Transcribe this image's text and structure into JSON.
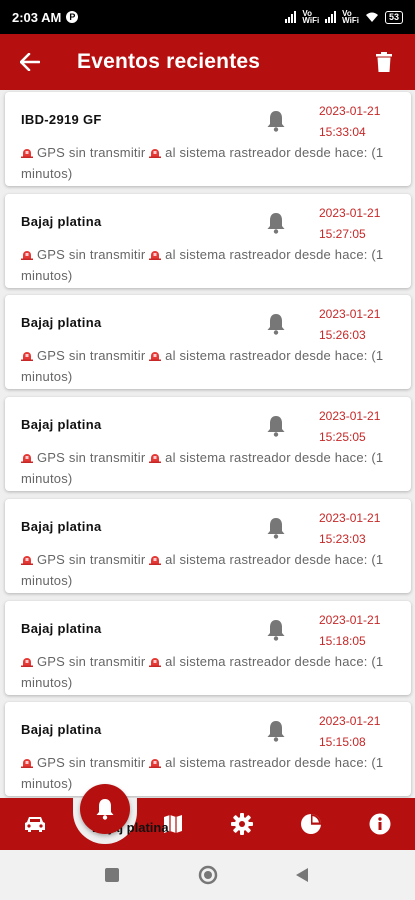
{
  "status_bar": {
    "time": "2:03 AM",
    "network_label_1": "Vo\nWiFi",
    "network_label_2": "Vo\nWiFi",
    "battery": "53"
  },
  "header": {
    "title": "Eventos recientes",
    "back_icon": "arrow-left-icon",
    "delete_icon": "trash-icon"
  },
  "events": [
    {
      "title": "IBD-2919 GF",
      "date": "2023-01-21",
      "time": "15:33:04",
      "message_part1": "GPS sin transmitir",
      "message_part2": "al sistema rastreador desde hace: (1 minutos)"
    },
    {
      "title": "Bajaj platina",
      "date": "2023-01-21",
      "time": "15:27:05",
      "message_part1": "GPS sin transmitir",
      "message_part2": "al sistema rastreador desde hace: (1 minutos)"
    },
    {
      "title": "Bajaj platina",
      "date": "2023-01-21",
      "time": "15:26:03",
      "message_part1": "GPS sin transmitir",
      "message_part2": "al sistema rastreador desde hace: (1 minutos)"
    },
    {
      "title": "Bajaj platina",
      "date": "2023-01-21",
      "time": "15:25:05",
      "message_part1": "GPS sin transmitir",
      "message_part2": "al sistema rastreador desde hace: (1 minutos)"
    },
    {
      "title": "Bajaj platina",
      "date": "2023-01-21",
      "time": "15:23:03",
      "message_part1": "GPS sin transmitir",
      "message_part2": "al sistema rastreador desde hace: (1 minutos)"
    },
    {
      "title": "Bajaj platina",
      "date": "2023-01-21",
      "time": "15:18:05",
      "message_part1": "GPS sin transmitir",
      "message_part2": "al sistema rastreador desde hace: (1 minutos)"
    },
    {
      "title": "Bajaj platina",
      "date": "2023-01-21",
      "time": "15:15:08",
      "message_part1": "GPS sin transmitir",
      "message_part2": "al sistema rastreador desde hace: (1 minutos)"
    }
  ],
  "peek_title": "Bajaj platina",
  "bottom_nav": {
    "items": [
      "car-icon",
      "bell-icon",
      "map-icon",
      "gear-icon",
      "pie-chart-icon",
      "info-icon"
    ],
    "active": "bell-icon"
  },
  "colors": {
    "primary": "#b50f0f",
    "date_text": "#c62828",
    "message_text": "#666666",
    "background": "#efefef"
  }
}
